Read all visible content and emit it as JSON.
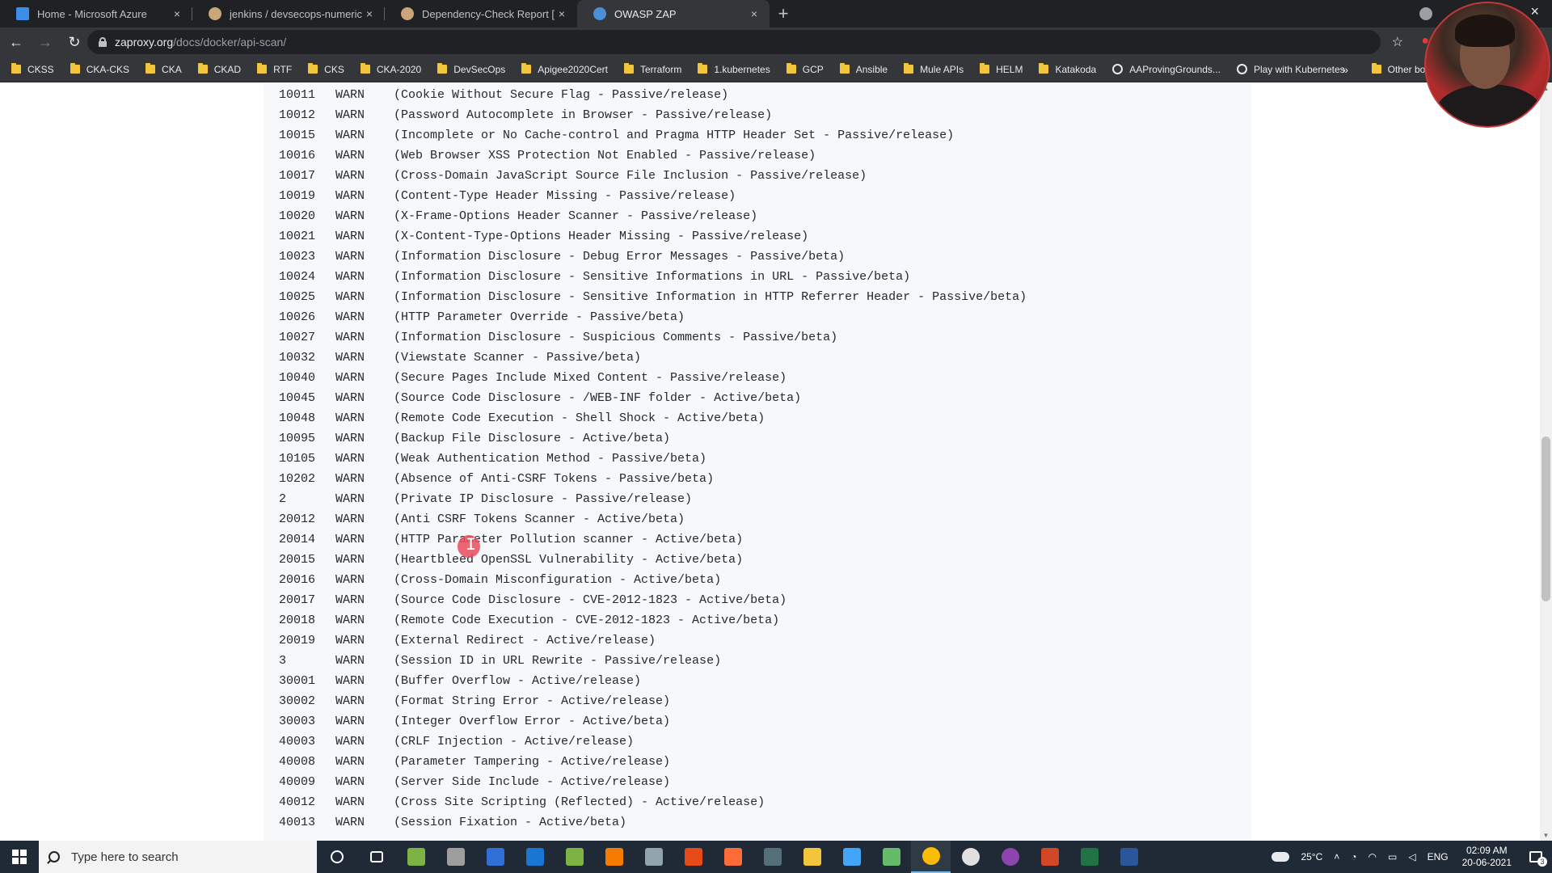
{
  "browser": {
    "tabs": [
      {
        "title": "Home - Microsoft Azure",
        "icon": "azure-icon",
        "active": false
      },
      {
        "title": "jenkins / devsecops-numeric-app",
        "icon": "jenkins-icon",
        "active": false
      },
      {
        "title": "Dependency-Check Report [Jenki",
        "icon": "jenkins-icon",
        "active": false
      },
      {
        "title": "OWASP ZAP",
        "icon": "zap-icon",
        "active": true
      }
    ],
    "new_tab_label": "+",
    "close_glyph": "×",
    "url_host": "zaproxy.org",
    "url_path": "/docs/docker/api-scan/",
    "bookmarks": [
      {
        "label": "CKSS",
        "type": "folder"
      },
      {
        "label": "CKA-CKS",
        "type": "folder"
      },
      {
        "label": "CKA",
        "type": "folder"
      },
      {
        "label": "CKAD",
        "type": "folder"
      },
      {
        "label": "RTF",
        "type": "folder"
      },
      {
        "label": "CKS",
        "type": "folder"
      },
      {
        "label": "CKA-2020",
        "type": "folder"
      },
      {
        "label": "DevSecOps",
        "type": "folder"
      },
      {
        "label": "Apigee2020Cert",
        "type": "folder"
      },
      {
        "label": "Terraform",
        "type": "folder"
      },
      {
        "label": "1.kubernetes",
        "type": "folder"
      },
      {
        "label": "GCP",
        "type": "folder"
      },
      {
        "label": "Ansible",
        "type": "folder"
      },
      {
        "label": "Mule APIs",
        "type": "folder"
      },
      {
        "label": "HELM",
        "type": "folder"
      },
      {
        "label": "Katakoda",
        "type": "folder"
      },
      {
        "label": "AAProvingGrounds...",
        "type": "page"
      },
      {
        "label": "Play with Kubernetes",
        "type": "page"
      }
    ],
    "bookmarks_more": "»",
    "other_bookmarks": "Other boo"
  },
  "content": {
    "rules": [
      {
        "id": "10011",
        "level": "WARN",
        "desc": "(Cookie Without Secure Flag - Passive/release)"
      },
      {
        "id": "10012",
        "level": "WARN",
        "desc": "(Password Autocomplete in Browser - Passive/release)"
      },
      {
        "id": "10015",
        "level": "WARN",
        "desc": "(Incomplete or No Cache-control and Pragma HTTP Header Set - Passive/release)"
      },
      {
        "id": "10016",
        "level": "WARN",
        "desc": "(Web Browser XSS Protection Not Enabled - Passive/release)"
      },
      {
        "id": "10017",
        "level": "WARN",
        "desc": "(Cross-Domain JavaScript Source File Inclusion - Passive/release)"
      },
      {
        "id": "10019",
        "level": "WARN",
        "desc": "(Content-Type Header Missing - Passive/release)"
      },
      {
        "id": "10020",
        "level": "WARN",
        "desc": "(X-Frame-Options Header Scanner - Passive/release)"
      },
      {
        "id": "10021",
        "level": "WARN",
        "desc": "(X-Content-Type-Options Header Missing - Passive/release)"
      },
      {
        "id": "10023",
        "level": "WARN",
        "desc": "(Information Disclosure - Debug Error Messages - Passive/beta)"
      },
      {
        "id": "10024",
        "level": "WARN",
        "desc": "(Information Disclosure - Sensitive Informations in URL - Passive/beta)"
      },
      {
        "id": "10025",
        "level": "WARN",
        "desc": "(Information Disclosure - Sensitive Information in HTTP Referrer Header - Passive/beta)"
      },
      {
        "id": "10026",
        "level": "WARN",
        "desc": "(HTTP Parameter Override - Passive/beta)"
      },
      {
        "id": "10027",
        "level": "WARN",
        "desc": "(Information Disclosure - Suspicious Comments - Passive/beta)"
      },
      {
        "id": "10032",
        "level": "WARN",
        "desc": "(Viewstate Scanner - Passive/beta)"
      },
      {
        "id": "10040",
        "level": "WARN",
        "desc": "(Secure Pages Include Mixed Content - Passive/release)"
      },
      {
        "id": "10045",
        "level": "WARN",
        "desc": "(Source Code Disclosure - /WEB-INF folder - Active/beta)"
      },
      {
        "id": "10048",
        "level": "WARN",
        "desc": "(Remote Code Execution - Shell Shock - Active/beta)"
      },
      {
        "id": "10095",
        "level": "WARN",
        "desc": "(Backup File Disclosure - Active/beta)"
      },
      {
        "id": "10105",
        "level": "WARN",
        "desc": "(Weak Authentication Method - Passive/beta)"
      },
      {
        "id": "10202",
        "level": "WARN",
        "desc": "(Absence of Anti-CSRF Tokens - Passive/beta)"
      },
      {
        "id": "2",
        "level": "WARN",
        "desc": "(Private IP Disclosure - Passive/release)"
      },
      {
        "id": "20012",
        "level": "WARN",
        "desc": "(Anti CSRF Tokens Scanner - Active/beta)"
      },
      {
        "id": "20014",
        "level": "WARN",
        "desc": "(HTTP Parameter Pollution scanner - Active/beta)"
      },
      {
        "id": "20015",
        "level": "WARN",
        "desc": "(Heartbleed OpenSSL Vulnerability - Active/beta)"
      },
      {
        "id": "20016",
        "level": "WARN",
        "desc": "(Cross-Domain Misconfiguration - Active/beta)"
      },
      {
        "id": "20017",
        "level": "WARN",
        "desc": "(Source Code Disclosure - CVE-2012-1823 - Active/beta)"
      },
      {
        "id": "20018",
        "level": "WARN",
        "desc": "(Remote Code Execution - CVE-2012-1823 - Active/beta)"
      },
      {
        "id": "20019",
        "level": "WARN",
        "desc": "(External Redirect - Active/release)"
      },
      {
        "id": "3",
        "level": "WARN",
        "desc": "(Session ID in URL Rewrite - Passive/release)"
      },
      {
        "id": "30001",
        "level": "WARN",
        "desc": "(Buffer Overflow - Active/release)"
      },
      {
        "id": "30002",
        "level": "WARN",
        "desc": "(Format String Error - Active/release)"
      },
      {
        "id": "30003",
        "level": "WARN",
        "desc": "(Integer Overflow Error - Active/beta)"
      },
      {
        "id": "40003",
        "level": "WARN",
        "desc": "(CRLF Injection - Active/release)"
      },
      {
        "id": "40008",
        "level": "WARN",
        "desc": "(Parameter Tampering - Active/release)"
      },
      {
        "id": "40009",
        "level": "WARN",
        "desc": "(Server Side Include - Active/release)"
      },
      {
        "id": "40012",
        "level": "WARN",
        "desc": "(Cross Site Scripting (Reflected) - Active/release)"
      },
      {
        "id": "40013",
        "level": "WARN",
        "desc": "(Session Fixation - Active/beta)"
      }
    ]
  },
  "taskbar": {
    "search_placeholder": "Type here to search",
    "apps": [
      {
        "icon": "cortana-icon",
        "color": "#ffffff"
      },
      {
        "icon": "task-view-icon",
        "color": "#ffffff"
      },
      {
        "icon": "notepad-icon",
        "color": "#7cb342"
      },
      {
        "icon": "calculator-icon",
        "color": "#9e9e9e"
      },
      {
        "icon": "powershell-icon",
        "color": "#2f6fd6"
      },
      {
        "icon": "outlook-icon",
        "color": "#1976d2"
      },
      {
        "icon": "greenshot-icon",
        "color": "#7cb342"
      },
      {
        "icon": "sublime-icon",
        "color": "#f57c00"
      },
      {
        "icon": "terminal-icon",
        "color": "#90a4ae"
      },
      {
        "icon": "app-icon",
        "color": "#e64a19"
      },
      {
        "icon": "postman-icon",
        "color": "#ff6c37"
      },
      {
        "icon": "snipping-icon",
        "color": "#546e7a"
      },
      {
        "icon": "file-explorer-icon",
        "color": "#f2c53d"
      },
      {
        "icon": "network-icon",
        "color": "#42a5f5"
      },
      {
        "icon": "pen-icon",
        "color": "#66bb6a"
      },
      {
        "icon": "chrome-icon",
        "color": "#fbbc05"
      },
      {
        "icon": "obs-icon",
        "color": "#e0e0e0"
      },
      {
        "icon": "github-icon",
        "color": "#8e44ad"
      },
      {
        "icon": "powerpoint-icon",
        "color": "#d24726"
      },
      {
        "icon": "excel-icon",
        "color": "#217346"
      },
      {
        "icon": "word-icon",
        "color": "#2b579a"
      }
    ],
    "weather": "25°C",
    "language": "ENG",
    "time": "02:09 AM",
    "date": "20-06-2021",
    "notification_count": "3"
  }
}
